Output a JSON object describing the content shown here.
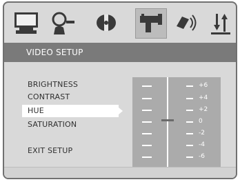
{
  "toolbar": {
    "icons": [
      {
        "name": "monitor-icon",
        "active": false
      },
      {
        "name": "language-person-icon",
        "active": false
      },
      {
        "name": "audio-disc-icon",
        "active": false
      },
      {
        "name": "video-camera-icon",
        "active": true
      },
      {
        "name": "speaker-icon",
        "active": false
      },
      {
        "name": "preferences-sort-icon",
        "active": false
      }
    ]
  },
  "page": {
    "title": "VIDEO SETUP"
  },
  "menu": {
    "items": [
      {
        "label": "BRIGHTNESS",
        "selected": false
      },
      {
        "label": "CONTRAST",
        "selected": false
      },
      {
        "label": "HUE",
        "selected": true
      },
      {
        "label": "SATURATION",
        "selected": false
      }
    ],
    "exit_label": "EXIT SETUP"
  },
  "slider": {
    "labels": [
      "+6",
      "+4",
      "+2",
      "0",
      "-2",
      "-4",
      "-6"
    ],
    "current_value": "0"
  },
  "colors": {
    "background": "#d9d9d9",
    "title_bar": "#7a7a7a",
    "slider_panel": "#ababab",
    "highlight": "#ffffff"
  }
}
